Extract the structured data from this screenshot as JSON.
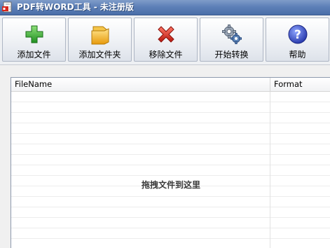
{
  "window": {
    "title": "PDF转WORD工具 - 未注册版",
    "app_icon": "pdf-document-icon"
  },
  "toolbar": {
    "buttons": [
      {
        "label": "添加文件",
        "icon": "add-plus-icon",
        "color": "#2ea62e"
      },
      {
        "label": "添加文件夹",
        "icon": "folder-icon",
        "color": "#f3b51c"
      },
      {
        "label": "移除文件",
        "icon": "remove-x-icon",
        "color": "#d8261c"
      },
      {
        "label": "开始转换",
        "icon": "gears-icon",
        "color": "#5c84b8"
      },
      {
        "label": "帮助",
        "icon": "help-question-icon",
        "color": "#3a4fc4"
      }
    ]
  },
  "file_list": {
    "columns": [
      "FileName",
      "Format"
    ],
    "rows": [],
    "drop_hint": "拖拽文件到这里"
  }
}
